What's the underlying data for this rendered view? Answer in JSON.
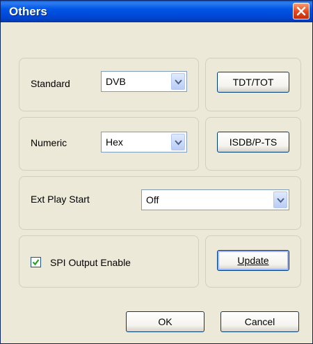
{
  "window": {
    "title": "Others"
  },
  "standard": {
    "label": "Standard",
    "value": "DVB"
  },
  "tdt_tot": {
    "label": "TDT/TOT"
  },
  "numeric": {
    "label": "Numeric",
    "value": "Hex"
  },
  "isdb": {
    "label": "ISDB/P-TS"
  },
  "ext_play": {
    "label": "Ext Play Start",
    "value": "Off"
  },
  "spi": {
    "label": "SPI Output Enable",
    "checked": true
  },
  "update": {
    "label": "Update"
  },
  "footer": {
    "ok_label": "OK",
    "cancel_label": "Cancel"
  },
  "icons": {
    "close": "close-icon",
    "dropdown": "chevron-down-icon",
    "check": "check-icon"
  },
  "colors": {
    "title_bar": "#0055e5",
    "close_button": "#e4451a",
    "dialog_bg": "#ece9d8"
  }
}
